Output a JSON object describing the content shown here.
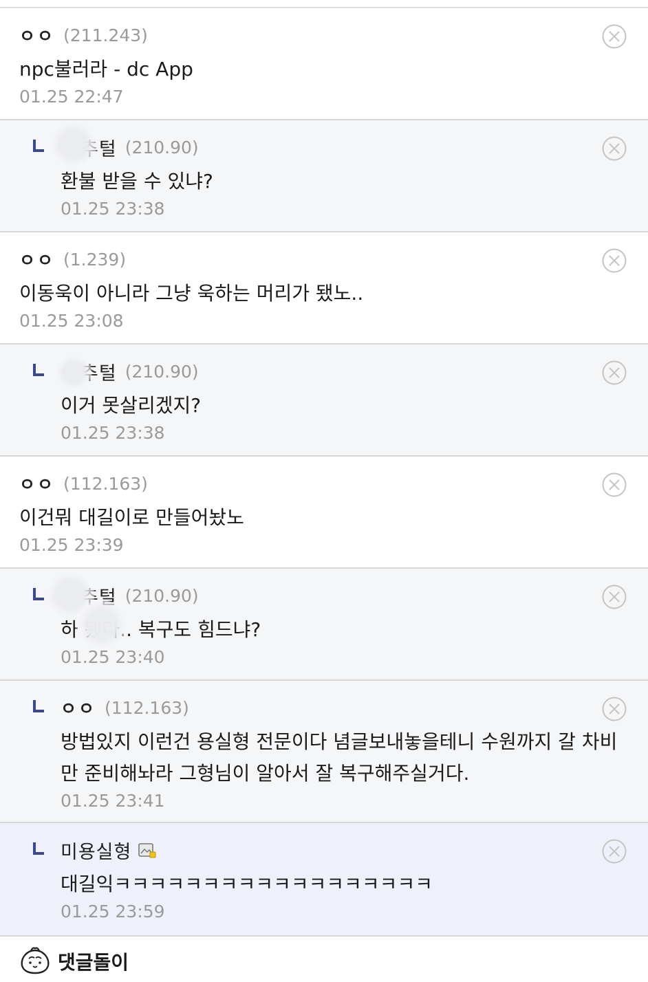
{
  "comments": [
    {
      "nick": "ㅇㅇ",
      "ip": "(211.243)",
      "body_lines": [
        "npc불러라 - dc App"
      ],
      "date": "01.25 22:47"
    },
    {
      "nick": "추털",
      "ip": "(210.90)",
      "body_lines": [
        "환불 받을 수 있냐?"
      ],
      "date": "01.25 23:38"
    },
    {
      "nick": "ㅇㅇ",
      "ip": "(1.239)",
      "body_lines": [
        "이동욱이 아니라 그냥 욱하는 머리가 됐노.."
      ],
      "date": "01.25 23:08"
    },
    {
      "nick": "추털",
      "ip": "(210.90)",
      "body_lines": [
        "이거 못살리겠지?"
      ],
      "date": "01.25 23:38"
    },
    {
      "nick": "ㅇㅇ",
      "ip": "(112.163)",
      "body_lines": [
        "이건뭐 대길이로 만들어놨노"
      ],
      "date": "01.25 23:39"
    },
    {
      "nick": "추털",
      "ip": "(210.90)",
      "body_lines": [
        "하 됐다.. 복구도 힘드냐?"
      ],
      "date": "01.25 23:40"
    },
    {
      "nick": "ㅇㅇ",
      "ip": "(112.163)",
      "body_lines": [
        "방법있지 이런건 용실형 전문이다 념글보내놓을테니 수원까지 갈 차비",
        "만 준비해놔라 그형님이 알아서 잘 복구해주실거다."
      ],
      "date": "01.25 23:41"
    },
    {
      "nick": "미용실형",
      "body_lines": [
        "대길익ㅋㅋㅋㅋㅋㅋㅋㅋㅋㅋㅋㅋㅋㅋㅋㅋㅋㅋ"
      ],
      "date": "01.25 23:59"
    }
  ],
  "footer": {
    "label": "댓글돌이"
  },
  "icons": {
    "reply_marker": "reply-arrow-icon",
    "delete": "close-circle-icon",
    "user_badge": "gallery-member-icon",
    "bot": "dumpling-mascot-icon"
  },
  "colors": {
    "reply_marker": "#3b4890",
    "reply_background": "#f5f6f8",
    "highlight_background": "#eef1f9",
    "meta_text": "#9a9a9a"
  }
}
